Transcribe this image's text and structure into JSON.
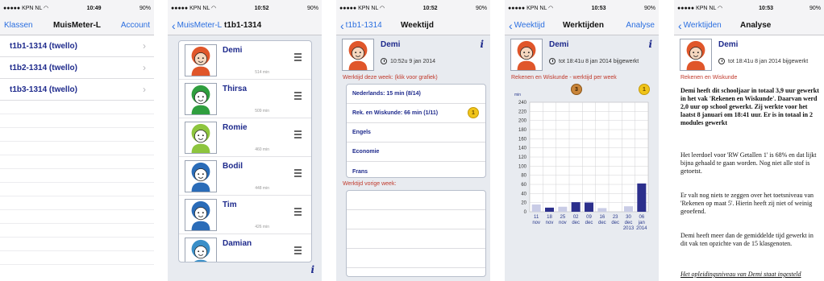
{
  "status": {
    "carrier": "●●●●● KPN NL ◠",
    "battery": "90%",
    "times": [
      "10:49",
      "10:52",
      "10:52",
      "10:53",
      "10:53"
    ]
  },
  "screen1": {
    "nav_left": "Klassen",
    "nav_title": "MuisMeter-L",
    "nav_right": "Account",
    "rows": [
      "t1b1-1314 (twello)",
      "t1b2-1314 (twello)",
      "t1b3-1314 (twello)"
    ],
    "chevron": "›"
  },
  "screen2": {
    "nav_back": "MuisMeter-L",
    "nav_title": "t1b1-1314",
    "students": [
      {
        "name": "Demi",
        "minutes": "514 min",
        "hair": "#e0562a",
        "shirt": "#e0562a",
        "face": "#f6d7bf"
      },
      {
        "name": "Thirsa",
        "minutes": "509 min",
        "hair": "#2f9e3e",
        "shirt": "#2f9e3e",
        "face": "#ffffff"
      },
      {
        "name": "Romie",
        "minutes": "460 min",
        "hair": "#8dc53e",
        "shirt": "#8dc53e",
        "face": "#ffffff"
      },
      {
        "name": "Bodil",
        "minutes": "448 min",
        "hair": "#2a6cb8",
        "shirt": "#2a6cb8",
        "face": "#ffffff"
      },
      {
        "name": "Tim",
        "minutes": "426 min",
        "hair": "#2a6cb8",
        "shirt": "#2a6cb8",
        "face": "#ffffff"
      },
      {
        "name": "Damian",
        "minutes": "",
        "hair": "#3a8fc8",
        "shirt": "#3a8fc8",
        "face": "#ffffff"
      }
    ],
    "info_icon": "i"
  },
  "screen3": {
    "nav_back": "t1b1-1314",
    "nav_title": "Weektijd",
    "name": "Demi",
    "time": "10:52u 9 jan 2014",
    "this_week_label": "Werktijd deze week: (klik voor grafiek)",
    "rows": [
      "Nederlands: 15 min  (8/14)",
      "Rek. en Wiskunde: 66 min  (1/11)",
      "Engels",
      "Economie",
      "Frans"
    ],
    "medal_label": "1",
    "last_week_label": "Werktijd vorige week:",
    "info_icon": "i"
  },
  "screen4": {
    "nav_back": "Weektijd",
    "nav_title": "Werktijden",
    "nav_right": "Analyse",
    "name": "Demi",
    "time": "tot 18:41u 8 jan 2014 bijgewerkt",
    "chart_heading": "Rekenen en Wiskunde - werktijd per week",
    "medal_a": "3",
    "medal_b": "1",
    "info_icon": "i",
    "chart_data": {
      "type": "bar",
      "ylabel": "min",
      "ylim": [
        0,
        240
      ],
      "yticks": [
        0,
        20,
        40,
        60,
        80,
        100,
        120,
        140,
        160,
        180,
        200,
        220,
        240
      ],
      "categories": [
        [
          "11",
          "nov"
        ],
        [
          "18",
          "nov"
        ],
        [
          "25",
          "nov"
        ],
        [
          "02",
          "dec"
        ],
        [
          "09",
          "dec"
        ],
        [
          "16",
          "dec"
        ],
        [
          "23",
          "dec"
        ],
        [
          "30",
          "dec",
          "2013"
        ],
        [
          "06",
          "jan",
          "2014"
        ]
      ],
      "series": [
        {
          "color": "#c9cce6",
          "values": [
            16,
            9,
            11,
            0,
            22,
            8,
            0,
            12,
            14
          ]
        },
        {
          "color": "#2c2f8c",
          "values": [
            0,
            9,
            0,
            21,
            20,
            0,
            0,
            0,
            62
          ]
        }
      ],
      "grid": true
    }
  },
  "screen5": {
    "nav_back": "Werktijden",
    "nav_title": "Analyse",
    "name": "Demi",
    "time": "tot 18:41u 8 jan 2014 bijgewerkt",
    "subject": "Rekenen en Wiskunde",
    "p1": "Demi heeft dit schooljaar in totaal 3,9 uur gewerkt in het vak 'Rekenen en Wiskunde'. Daarvan werd 2,0 uur op school gewerkt. Zij werkte voor het laatst 8 januari om 18:41 uur. Er is in totaal in 2 modules gewerkt",
    "p2": "Het leerdoel voor 'RW Getallen 1' is 68% en dat lijkt bijna gehaald te gaan worden. Nog niet alle stof is getoetst.",
    "p3": "Er valt nog niets te zeggen over het toetsniveau van 'Rekenen op maat 5'. Hierin heeft zij niet of weinig geoefend.",
    "p4": "Demi heeft meer dan de gemiddelde tijd gewerkt in dit vak ten opzichte van de 15 klasgenoten.",
    "p5": "Het opleidingsniveau van Demi staat ingesteld"
  }
}
